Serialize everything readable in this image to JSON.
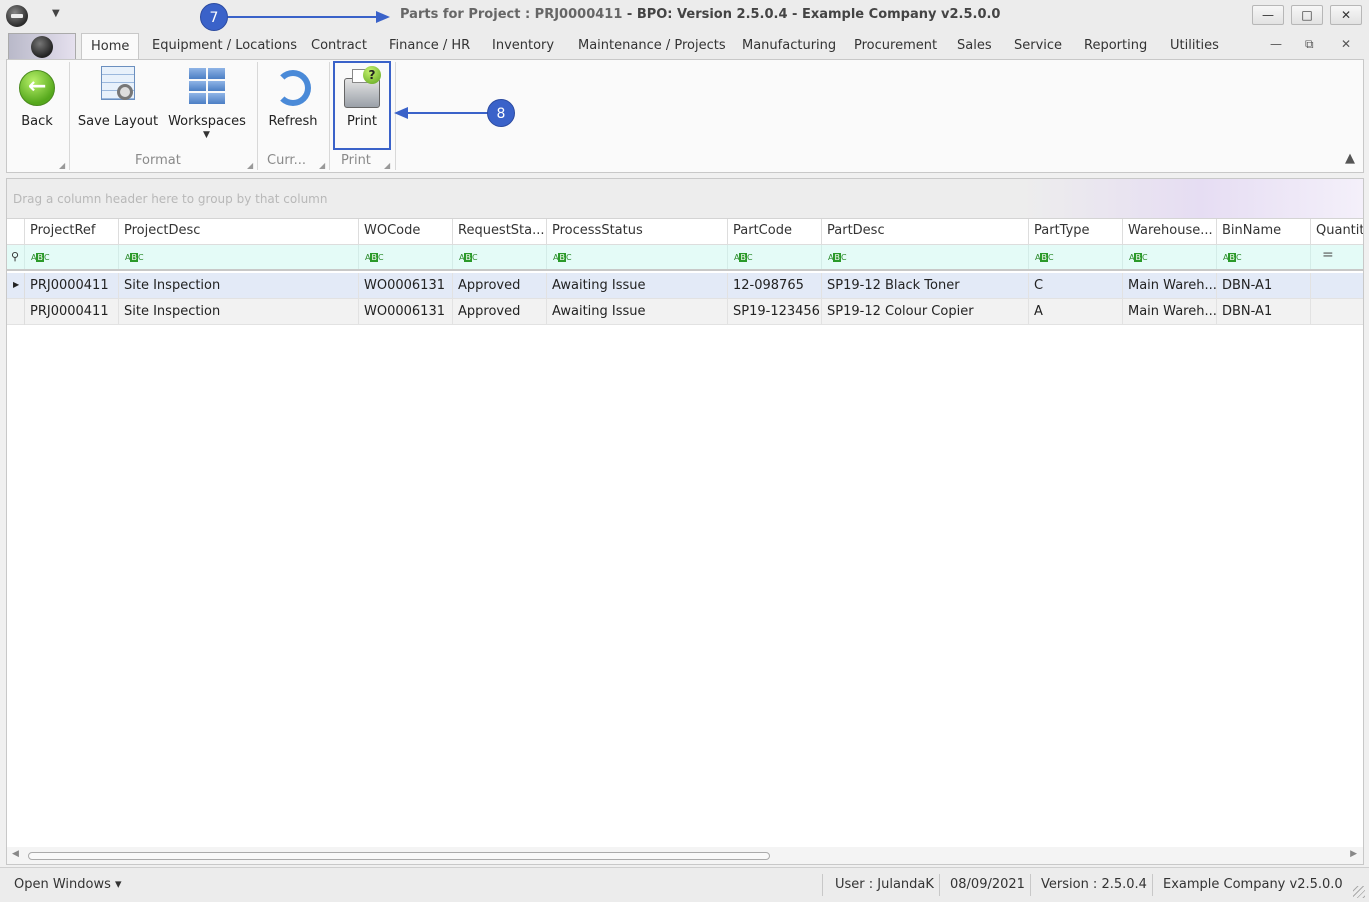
{
  "window": {
    "title_prefix": "Parts for Project : PRJ0000411",
    "title_suffix": " - BPO: Version 2.5.0.4 - Example Company v2.5.0.0",
    "minimize_glyph": "—",
    "maximize_glyph": "□",
    "close_glyph": "✕"
  },
  "qat": {
    "dropdown_glyph": "▼"
  },
  "callouts": {
    "c7": "7",
    "c8": "8"
  },
  "tabs": [
    "Home",
    "Equipment / Locations",
    "Contract",
    "Finance / HR",
    "Inventory",
    "Maintenance / Projects",
    "Manufacturing",
    "Procurement",
    "Sales",
    "Service",
    "Reporting",
    "Utilities"
  ],
  "mdi": {
    "minimize": "—",
    "restore": "⧉",
    "close": "✕"
  },
  "ribbon": {
    "back": "Back",
    "save_layout": "Save Layout",
    "workspaces": "Workspaces",
    "refresh": "Refresh",
    "print": "Print",
    "print_badge": "?",
    "groups": {
      "format": "Format",
      "current": "Curr...",
      "print": "Print"
    },
    "collapse_glyph": "▲"
  },
  "grid": {
    "group_panel_text": "Drag a column header here to group by that column",
    "columns": [
      "ProjectRef",
      "ProjectDesc",
      "WOCode",
      "RequestSta...",
      "ProcessStatus",
      "PartCode",
      "PartDesc",
      "PartType",
      "Warehouse...",
      "BinName",
      "Quantity"
    ],
    "filter_icon": "⚲",
    "filter_equals": "=",
    "rows": [
      [
        "PRJ0000411",
        "Site Inspection",
        "WO0006131",
        "Approved",
        "Awaiting Issue",
        "12-098765",
        "SP19-12 Black Toner",
        "C",
        "Main Wareh...",
        "DBN-A1",
        ""
      ],
      [
        "PRJ0000411",
        "Site Inspection",
        "WO0006131",
        "Approved",
        "Awaiting Issue",
        "SP19-123456",
        "SP19-12 Colour Copier",
        "A",
        "Main Wareh...",
        "DBN-A1",
        ""
      ]
    ],
    "row_indicator": "▶"
  },
  "statusbar": {
    "open_windows": "Open Windows ▾",
    "user": "User : JulandaK",
    "date": "08/09/2021",
    "version": "Version : 2.5.0.4",
    "company": "Example Company v2.5.0.0"
  }
}
